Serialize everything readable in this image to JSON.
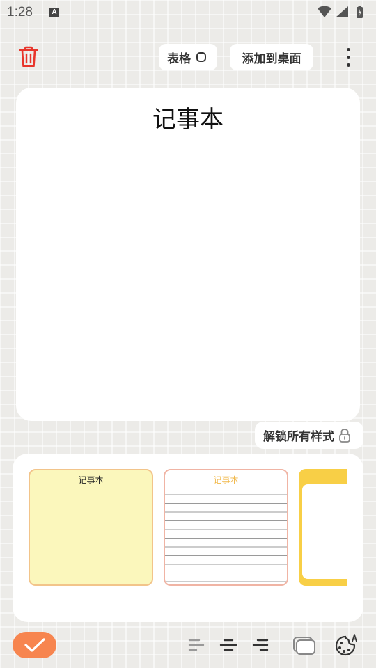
{
  "status_bar": {
    "time": "1:28",
    "notification_badge": "A"
  },
  "toolbar": {
    "table_label": "表格",
    "add_to_desktop_label": "添加到桌面"
  },
  "note": {
    "title": "记事本"
  },
  "unlock": {
    "label": "解锁所有样式"
  },
  "styles": {
    "items": [
      {
        "label": "记事本",
        "style": "yellow"
      },
      {
        "label": "记事本",
        "style": "lined"
      },
      {
        "label": "",
        "style": "orange"
      }
    ]
  },
  "colors": {
    "accent": "#f7854f",
    "trash": "#e8352b",
    "background": "#ecebe8",
    "yellow_paper": "#fbf7bc",
    "orange_paper": "#f8cf46"
  },
  "icons": {
    "trash": "trash-icon",
    "more": "more-vertical-icon",
    "lock": "lock-icon",
    "confirm": "check-icon",
    "align_left": "align-left-icon",
    "align_center": "align-center-icon",
    "align_right": "align-right-icon",
    "layers": "layers-icon",
    "palette": "palette-icon"
  }
}
